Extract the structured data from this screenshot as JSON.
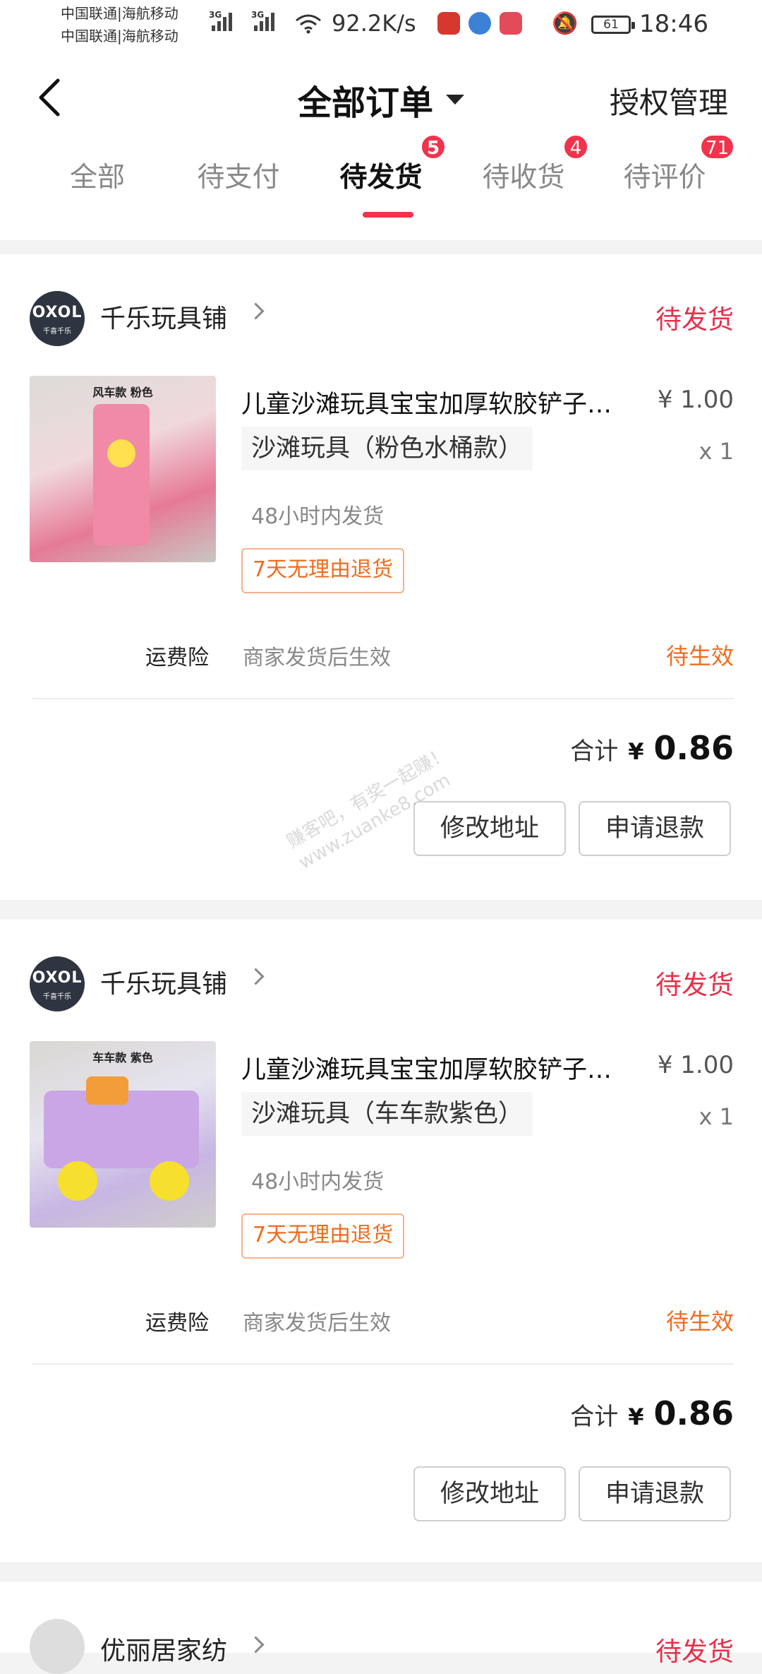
{
  "status_bar": {
    "carrier_line1": "中国联通|海航移动",
    "carrier_line2": "中国联通|海航移动",
    "net_type_1": "3G",
    "net_type_2": "3G",
    "net_speed": "92.2K/s",
    "battery": "61",
    "time": "18:46",
    "icons": [
      "signal-icon",
      "wifi-icon",
      "app-icon",
      "browser-icon",
      "reader-icon",
      "bell-muted-icon",
      "battery-icon"
    ]
  },
  "header": {
    "title": "全部订单",
    "right_action": "授权管理"
  },
  "tabs": [
    {
      "label": "全部",
      "badge": ""
    },
    {
      "label": "待支付",
      "badge": ""
    },
    {
      "label": "待发货",
      "badge": "5"
    },
    {
      "label": "待收货",
      "badge": "4"
    },
    {
      "label": "待评价",
      "badge": "71"
    }
  ],
  "orders": [
    {
      "shop_name": "千乐玩具铺",
      "shop_avatar_text": "OXOL",
      "shop_avatar_sub": "千喜千乐",
      "status": "待发货",
      "product_title": "儿童沙滩玩具宝宝加厚软胶铲子桶套装",
      "product_image_label": "风车款 粉色",
      "price": "¥ 1.00",
      "sku": "沙滩玩具（粉色水桶款）",
      "qty": "x 1",
      "ship_note": "48小时内发货",
      "return_tag": "7天无理由退货",
      "insurance_label": "运费险",
      "insurance_value": "商家发货后生效",
      "insurance_status": "待生效",
      "total_label": "合计",
      "total_currency": "¥",
      "total_amount": "0.86",
      "btn_address": "修改地址",
      "btn_refund": "申请退款"
    },
    {
      "shop_name": "千乐玩具铺",
      "shop_avatar_text": "OXOL",
      "shop_avatar_sub": "千喜千乐",
      "status": "待发货",
      "product_title": "儿童沙滩玩具宝宝加厚软胶铲子桶套装",
      "product_image_label": "车车款 紫色",
      "price": "¥ 1.00",
      "sku": "沙滩玩具（车车款紫色）",
      "qty": "x 1",
      "ship_note": "48小时内发货",
      "return_tag": "7天无理由退货",
      "insurance_label": "运费险",
      "insurance_value": "商家发货后生效",
      "insurance_status": "待生效",
      "total_label": "合计",
      "total_currency": "¥",
      "total_amount": "0.86",
      "btn_address": "修改地址",
      "btn_refund": "申请退款"
    },
    {
      "shop_name": "优丽居家纺",
      "status": "待发货"
    }
  ],
  "watermark": {
    "line1": "赚客吧，有奖一起赚！",
    "line2": "www.zuanke8.com"
  },
  "colors": {
    "accent_red": "#f2334b",
    "status_red": "#e8304a",
    "orange": "#ef6c1f"
  }
}
